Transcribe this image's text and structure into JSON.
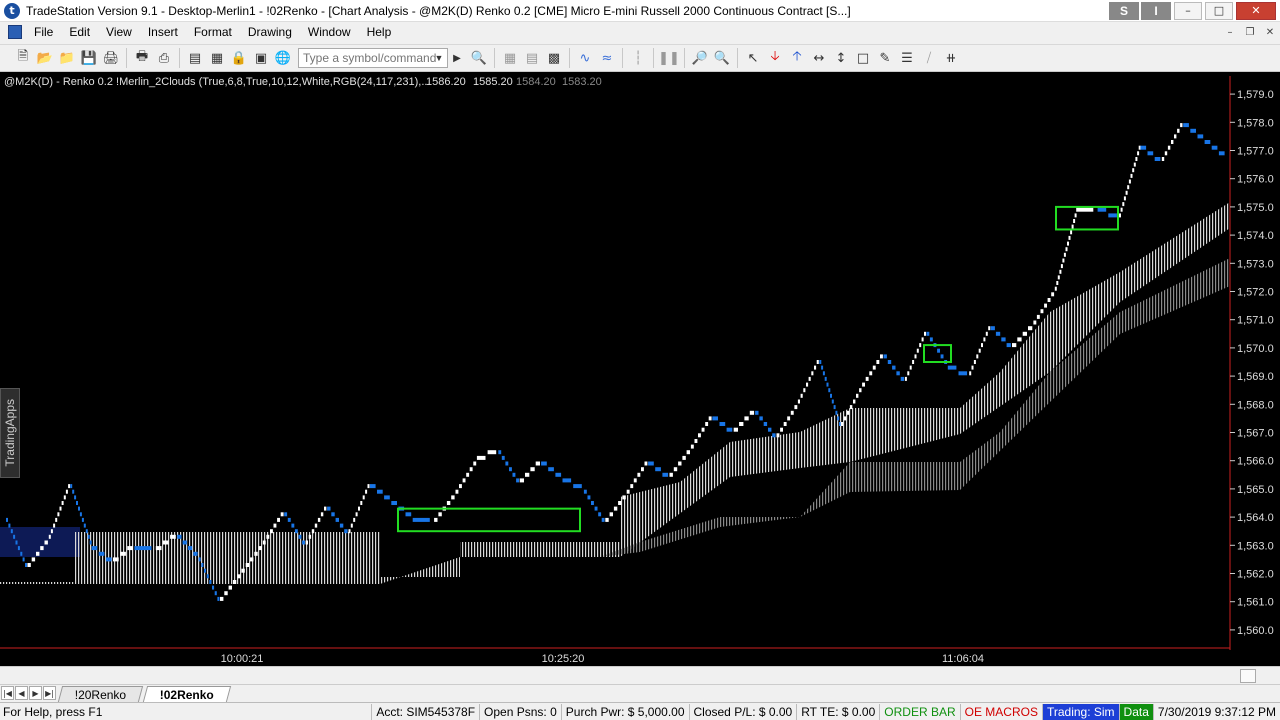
{
  "window": {
    "title": "TradeStation Version 9.1 - Desktop-Merlin1 - !02Renko - [Chart Analysis - @M2K(D) Renko 0.2 [CME] Micro E-mini Russell 2000 Continuous Contract [S...]",
    "badges": [
      "S",
      "I"
    ],
    "controls": [
      "–",
      "□",
      "✕"
    ]
  },
  "menu": {
    "items": [
      "File",
      "Edit",
      "View",
      "Insert",
      "Format",
      "Drawing",
      "Window",
      "Help"
    ]
  },
  "toolbar": {
    "symbol_placeholder": "Type a symbol/command"
  },
  "chart": {
    "header": "@M2K(D) - Renko 0.2  !Merlin_2Clouds (True,6,8,True,10,12,White,RGB(24,117,231),...",
    "header_values": [
      "1586.20",
      "1585.20",
      "1584.20",
      "1583.20"
    ],
    "side_tab": "TradingApps",
    "y_labels": [
      "1,579.0",
      "1,578.0",
      "1,577.0",
      "1,576.0",
      "1,575.0",
      "1,574.0",
      "1,573.0",
      "1,572.0",
      "1,571.0",
      "1,570.0",
      "1,569.0",
      "1,568.0",
      "1,567.0",
      "1,566.0",
      "1,565.0",
      "1,564.0",
      "1,563.0",
      "1,562.0",
      "1,561.0",
      "1,560.0"
    ],
    "x_labels": [
      "10:00:21",
      "10:25:20",
      "11:06:04"
    ],
    "colors": {
      "background": "#000000",
      "up_brick": "#ffffff",
      "down_brick": "#1875e7",
      "highlight_box": "#22dd22",
      "axis_line": "#cc2020"
    }
  },
  "chart_data": {
    "type": "line",
    "ylim": [
      1559.5,
      1579.5
    ],
    "x_ticks": [
      "10:00:21",
      "10:25:20",
      "11:06:04"
    ],
    "series": [
      {
        "name": "",
        "values": [
          1564.0,
          1562.2,
          1563.2,
          1565.2,
          1563.0,
          1562.4,
          1563.0,
          1562.8,
          1563.4,
          1562.6,
          1561.0,
          1562.0,
          1563.0,
          1564.2,
          1563.0,
          1564.4,
          1563.4,
          1565.2,
          1564.6,
          1564.0,
          1563.8,
          1564.8,
          1566.0,
          1566.4,
          1565.2,
          1566.0,
          1565.4,
          1565.0,
          1563.8,
          1564.8,
          1566.0,
          1565.4,
          1566.4,
          1567.6,
          1567.0,
          1567.8,
          1566.8,
          1568.0,
          1569.6,
          1567.2,
          1568.6,
          1569.8,
          1568.8,
          1570.6,
          1569.4,
          1569.0,
          1570.8,
          1570.0,
          1570.8,
          1572.0,
          1574.8,
          1575.0,
          1574.6,
          1577.2,
          1576.6,
          1578.0,
          1577.4,
          1576.8
        ]
      }
    ],
    "grid": false
  },
  "tabs": {
    "nav": [
      "|◀",
      "◀",
      "▶",
      "▶|"
    ],
    "items": [
      "!20Renko",
      "!02Renko"
    ],
    "active": 1
  },
  "status": {
    "help": "For Help, press F1",
    "acct": "Acct: SIM545378F",
    "open_psns": "Open Psns: 0",
    "purch_pwr": "Purch Pwr: $ 5,000.00",
    "closed_pl": "Closed P/L: $ 0.00",
    "rt_te": "RT TE: $ 0.00",
    "order_bar": "ORDER BAR",
    "oe_macros": "OE MACROS",
    "trading": "Trading: Sim",
    "data": "Data",
    "datetime": "7/30/2019 9:37:12 PM"
  }
}
